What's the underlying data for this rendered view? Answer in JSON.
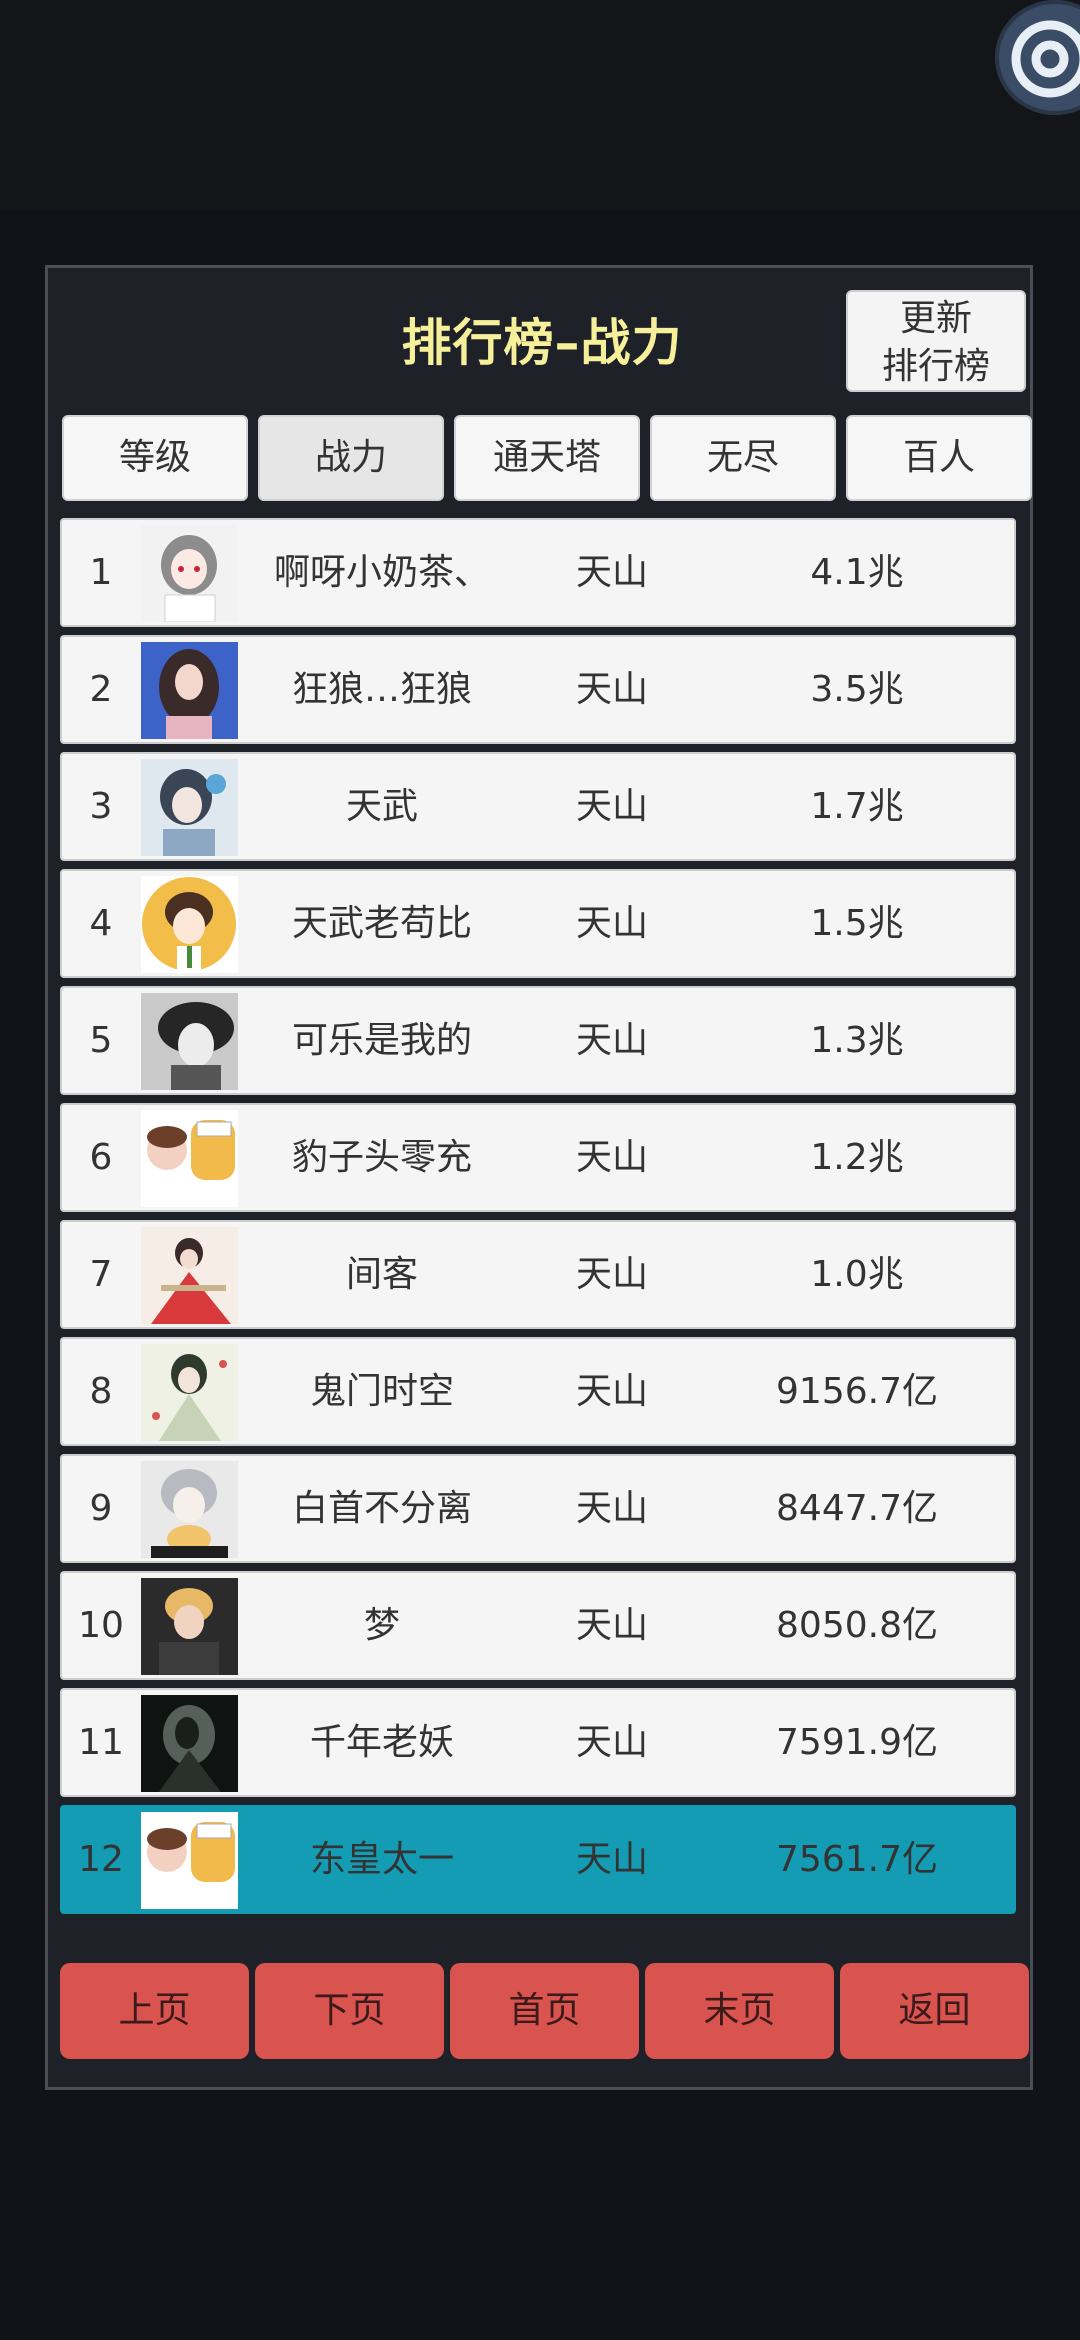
{
  "title": "排行榜–战力",
  "refresh_button": {
    "line1": "更新",
    "line2": "排行榜"
  },
  "tabs": [
    "等级",
    "战力",
    "通天塔",
    "无尽",
    "百人"
  ],
  "active_tab": "战力",
  "rows": [
    {
      "rank": "1",
      "name": "啊呀小奶茶、",
      "server": "天山",
      "power": "4.1兆"
    },
    {
      "rank": "2",
      "name": "狂狼…狂狼",
      "server": "天山",
      "power": "3.5兆"
    },
    {
      "rank": "3",
      "name": "天武",
      "server": "天山",
      "power": "1.7兆"
    },
    {
      "rank": "4",
      "name": "天武老苟比",
      "server": "天山",
      "power": "1.5兆"
    },
    {
      "rank": "5",
      "name": "可乐是我的",
      "server": "天山",
      "power": "1.3兆"
    },
    {
      "rank": "6",
      "name": "豹子头零充",
      "server": "天山",
      "power": "1.2兆"
    },
    {
      "rank": "7",
      "name": "间客",
      "server": "天山",
      "power": "1.0兆"
    },
    {
      "rank": "8",
      "name": "鬼门时空",
      "server": "天山",
      "power": "9156.7亿"
    },
    {
      "rank": "9",
      "name": "白首不分离",
      "server": "天山",
      "power": "8447.7亿"
    },
    {
      "rank": "10",
      "name": "梦",
      "server": "天山",
      "power": "8050.8亿"
    },
    {
      "rank": "11",
      "name": "千年老妖",
      "server": "天山",
      "power": "7591.9亿"
    },
    {
      "rank": "12",
      "name": "东皇太一",
      "server": "天山",
      "power": "7561.7亿"
    }
  ],
  "pager": [
    "上页",
    "下页",
    "首页",
    "末页",
    "返回"
  ],
  "colors": {
    "title": "#f7f09a",
    "highlight_row": "#149cb4",
    "pager_button": "#d9534f"
  }
}
